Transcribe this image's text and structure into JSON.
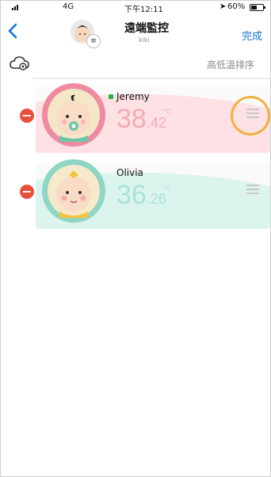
{
  "status_bar": {
    "network": "4G",
    "time": "下午12:11",
    "battery": "60%"
  },
  "nav": {
    "title": "遠端監控",
    "subtitle": "kiki"
  },
  "toolbar": {
    "sort_label": "高低溫排序"
  },
  "labels": {
    "done": "完成",
    "back_icon": "chevron-left-icon",
    "badge_icon": "list-icon"
  },
  "monitors": [
    {
      "name": "Jeremy",
      "temp_whole": "38",
      "temp_decimal": ".42",
      "unit": "°C",
      "online": true,
      "accent": "#f08aa0",
      "temp_color": "#f7a9b8",
      "card_color": "#fde1e5"
    },
    {
      "name": "Olivia",
      "temp_whole": "36",
      "temp_decimal": ".26",
      "unit": "°C",
      "online": false,
      "accent": "#8fd6c4",
      "temp_color": "#a9e3d6",
      "card_color": "#dcf4ee"
    }
  ],
  "colors": {
    "accent_blue": "#1474d6",
    "delete_red": "#e8503a",
    "drag_highlight": "#f0b23c"
  }
}
